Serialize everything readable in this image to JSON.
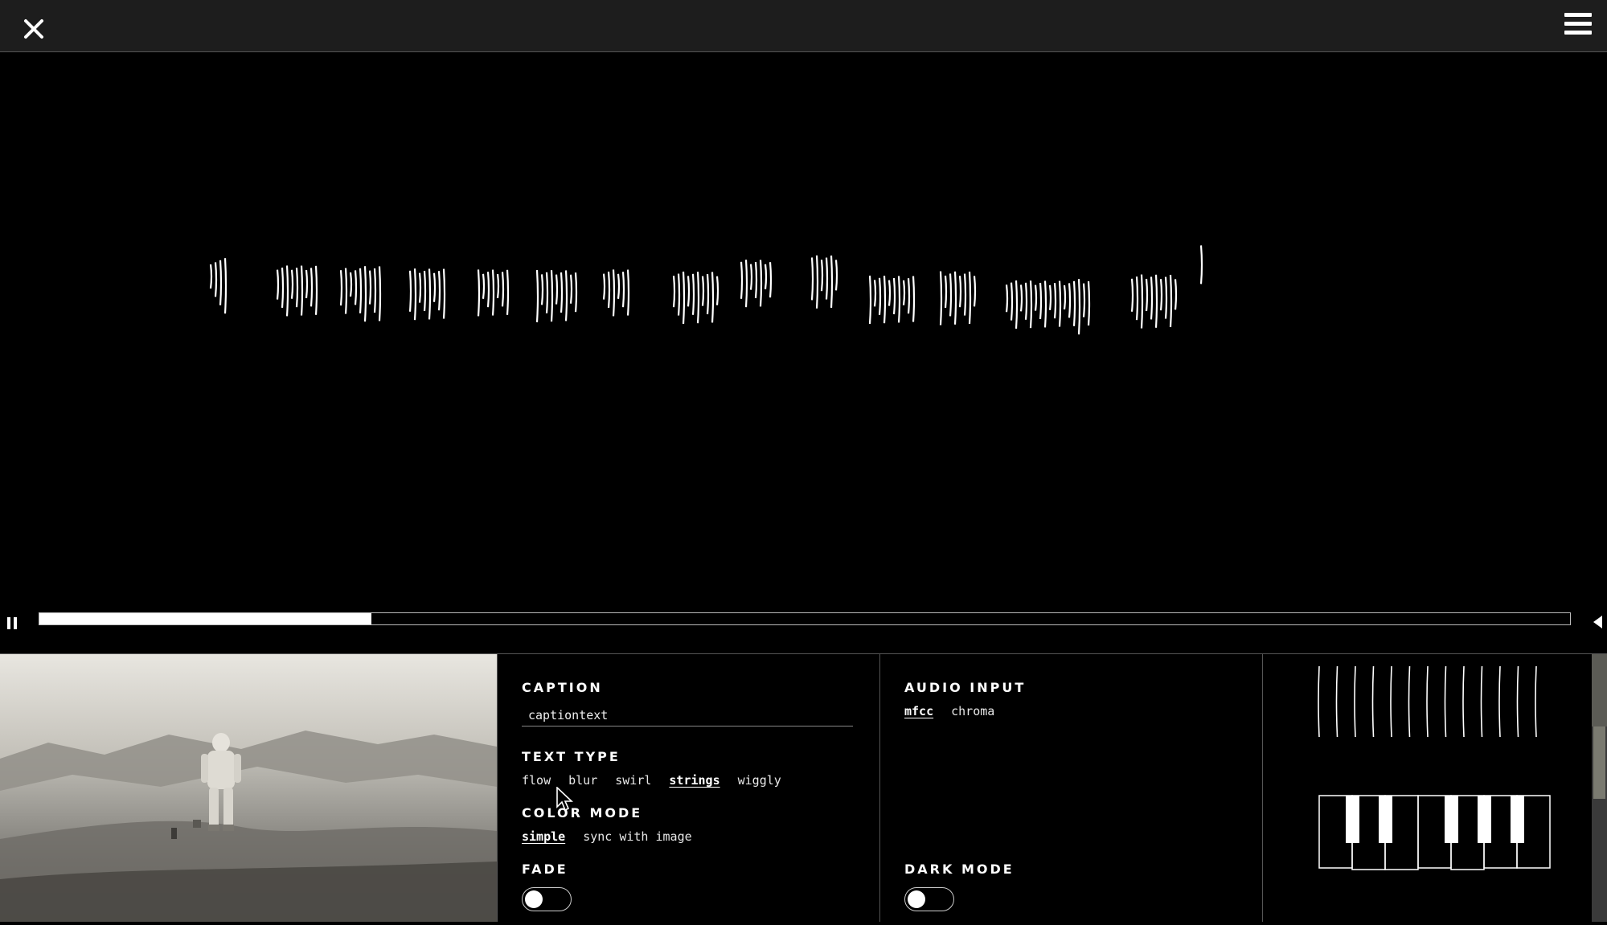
{
  "window": {
    "close_icon": "close-icon",
    "menu_icon": "hamburger-menu-icon"
  },
  "player": {
    "progress": 0.217,
    "pause_icon": "pause-icon",
    "volume_icon": "volume-icon"
  },
  "caption": {
    "heading": "CAPTION",
    "value": "captiontext",
    "placeholder": ""
  },
  "text_type": {
    "heading": "TEXT TYPE",
    "options": [
      "flow",
      "blur",
      "swirl",
      "strings",
      "wiggly"
    ],
    "selected": "strings"
  },
  "color_mode": {
    "heading": "COLOR MODE",
    "options": [
      "simple",
      "sync with image"
    ],
    "selected": "simple"
  },
  "fade": {
    "heading": "FADE",
    "on": false
  },
  "audio_input": {
    "heading": "AUDIO INPUT",
    "options": [
      "mfcc",
      "chroma"
    ],
    "selected": "mfcc"
  },
  "dark_mode": {
    "heading": "DARK MODE",
    "on": false
  },
  "colors": {
    "background": "#000000",
    "topbar": "#1d1d1d",
    "foreground": "#ffffff",
    "divider": "#555555"
  }
}
